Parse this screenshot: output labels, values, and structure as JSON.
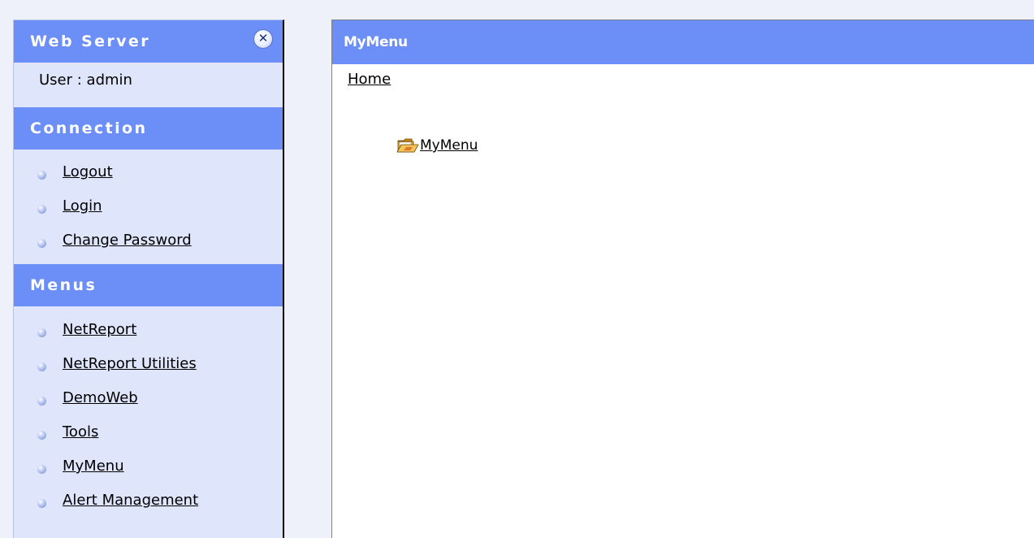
{
  "sidebar": {
    "title": "Web Server",
    "close_icon": "close-icon",
    "user_line": "User : admin",
    "sections": {
      "connection": {
        "title": "Connection",
        "items": [
          {
            "label": "Logout"
          },
          {
            "label": "Login"
          },
          {
            "label": "Change Password"
          }
        ]
      },
      "menus": {
        "title": "Menus",
        "items": [
          {
            "label": "NetReport"
          },
          {
            "label": "NetReport Utilities"
          },
          {
            "label": "DemoWeb"
          },
          {
            "label": "Tools"
          },
          {
            "label": "MyMenu"
          },
          {
            "label": "Alert Management"
          }
        ]
      }
    }
  },
  "main": {
    "title": "MyMenu",
    "breadcrumb": "Home",
    "folder": {
      "label": "MyMenu",
      "icon": "folder-open-icon"
    }
  },
  "colors": {
    "header_blue": "#6b8ef7",
    "sidebar_bg": "#dfe6fb",
    "page_bg": "#eef0fa"
  }
}
